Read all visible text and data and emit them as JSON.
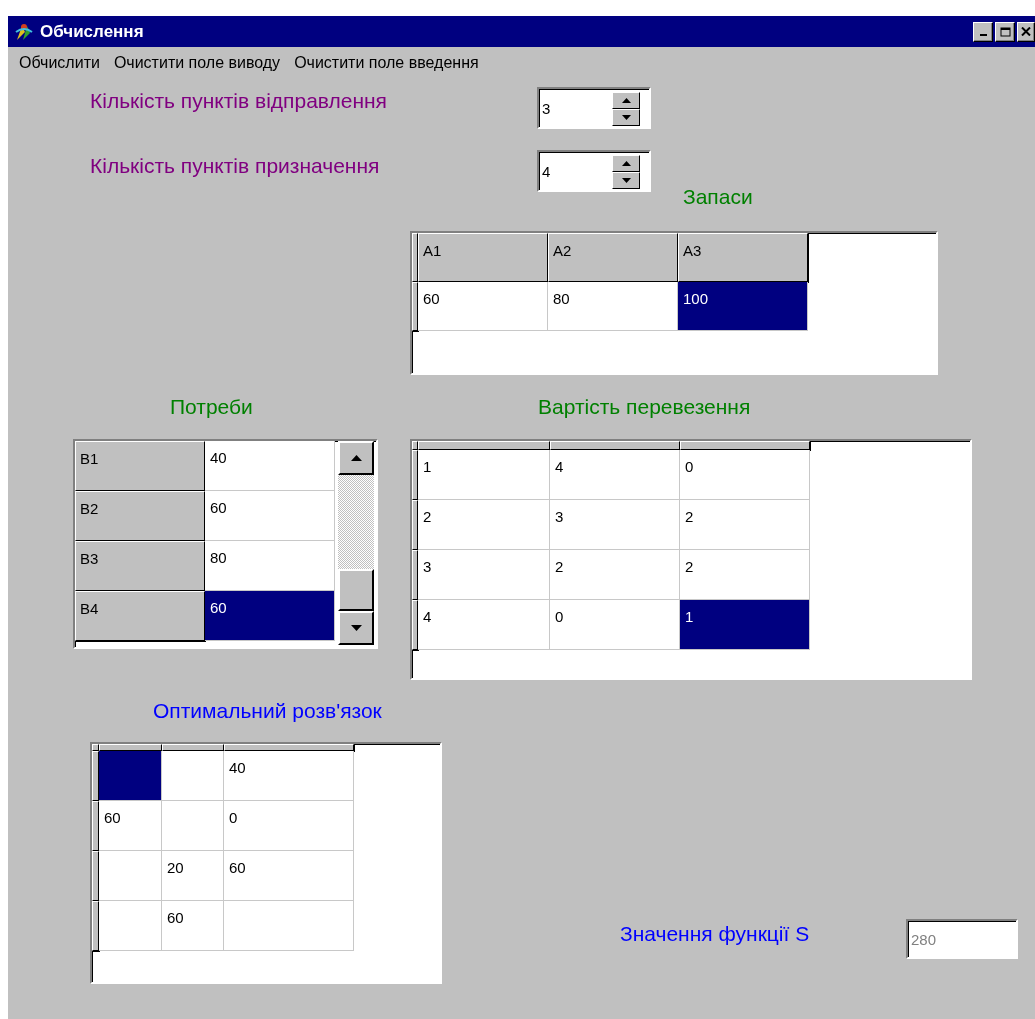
{
  "window": {
    "title": "Обчислення"
  },
  "menu": [
    "Обчислити",
    "Очистити поле виводу",
    "Очистити поле введення"
  ],
  "spinners": [
    {
      "label": "Кількість пунктів відправлення",
      "value": "3"
    },
    {
      "label": "Кількість пунктів призначення",
      "value": "4"
    }
  ],
  "supplies": {
    "title": "Запаси",
    "header_strip": false,
    "row_stub": true,
    "scrollbar": false,
    "rows": [
      [
        {
          "kind": "fixed",
          "text": "A1"
        },
        {
          "kind": "fixed",
          "text": "A2"
        },
        {
          "kind": "fixed",
          "text": "A3"
        }
      ],
      [
        {
          "kind": "data",
          "text": "60",
          "selected": false
        },
        {
          "kind": "data",
          "text": "80",
          "selected": false
        },
        {
          "kind": "data",
          "text": "100",
          "selected": true
        }
      ]
    ]
  },
  "demands": {
    "title": "Потреби",
    "header_strip": false,
    "row_stub": false,
    "scrollbar": true,
    "rows": [
      [
        {
          "kind": "fixed",
          "text": "B1"
        },
        {
          "kind": "data",
          "text": "40",
          "selected": false
        }
      ],
      [
        {
          "kind": "fixed",
          "text": "B2"
        },
        {
          "kind": "data",
          "text": "60",
          "selected": false
        }
      ],
      [
        {
          "kind": "fixed",
          "text": "B3"
        },
        {
          "kind": "data",
          "text": "80",
          "selected": false
        }
      ],
      [
        {
          "kind": "fixed",
          "text": "B4"
        },
        {
          "kind": "data",
          "text": "60",
          "selected": true
        }
      ]
    ]
  },
  "costs": {
    "title": "Вартість перевезення",
    "header_strip": true,
    "row_stub": true,
    "scrollbar": false,
    "rows": [
      [
        {
          "kind": "data",
          "text": "1",
          "selected": false
        },
        {
          "kind": "data",
          "text": "4",
          "selected": false
        },
        {
          "kind": "data",
          "text": "0",
          "selected": false
        }
      ],
      [
        {
          "kind": "data",
          "text": "2",
          "selected": false
        },
        {
          "kind": "data",
          "text": "3",
          "selected": false
        },
        {
          "kind": "data",
          "text": "2",
          "selected": false
        }
      ],
      [
        {
          "kind": "data",
          "text": "3",
          "selected": false
        },
        {
          "kind": "data",
          "text": "2",
          "selected": false
        },
        {
          "kind": "data",
          "text": "2",
          "selected": false
        }
      ],
      [
        {
          "kind": "data",
          "text": "4",
          "selected": false
        },
        {
          "kind": "data",
          "text": "0",
          "selected": false
        },
        {
          "kind": "data",
          "text": "1",
          "selected": true
        }
      ]
    ]
  },
  "solution": {
    "title": "Оптимальний розв'язок",
    "header_strip": true,
    "row_stub": true,
    "scrollbar": false,
    "rows": [
      [
        {
          "kind": "data",
          "selected": true
        },
        {
          "kind": "data",
          "selected": false
        },
        {
          "kind": "data",
          "text": "40",
          "selected": false
        }
      ],
      [
        {
          "kind": "data",
          "text": "60",
          "selected": false
        },
        {
          "kind": "data",
          "selected": false
        },
        {
          "kind": "data",
          "text": "0",
          "selected": false
        }
      ],
      [
        {
          "kind": "data",
          "selected": false
        },
        {
          "kind": "data",
          "text": "20",
          "selected": false
        },
        {
          "kind": "data",
          "text": "60",
          "selected": false
        }
      ],
      [
        {
          "kind": "data",
          "selected": false
        },
        {
          "kind": "data",
          "text": "60",
          "selected": false
        },
        {
          "kind": "data",
          "selected": false
        }
      ]
    ]
  },
  "objective": {
    "label": "Значення функції S",
    "value": "280",
    "disabled": true
  }
}
